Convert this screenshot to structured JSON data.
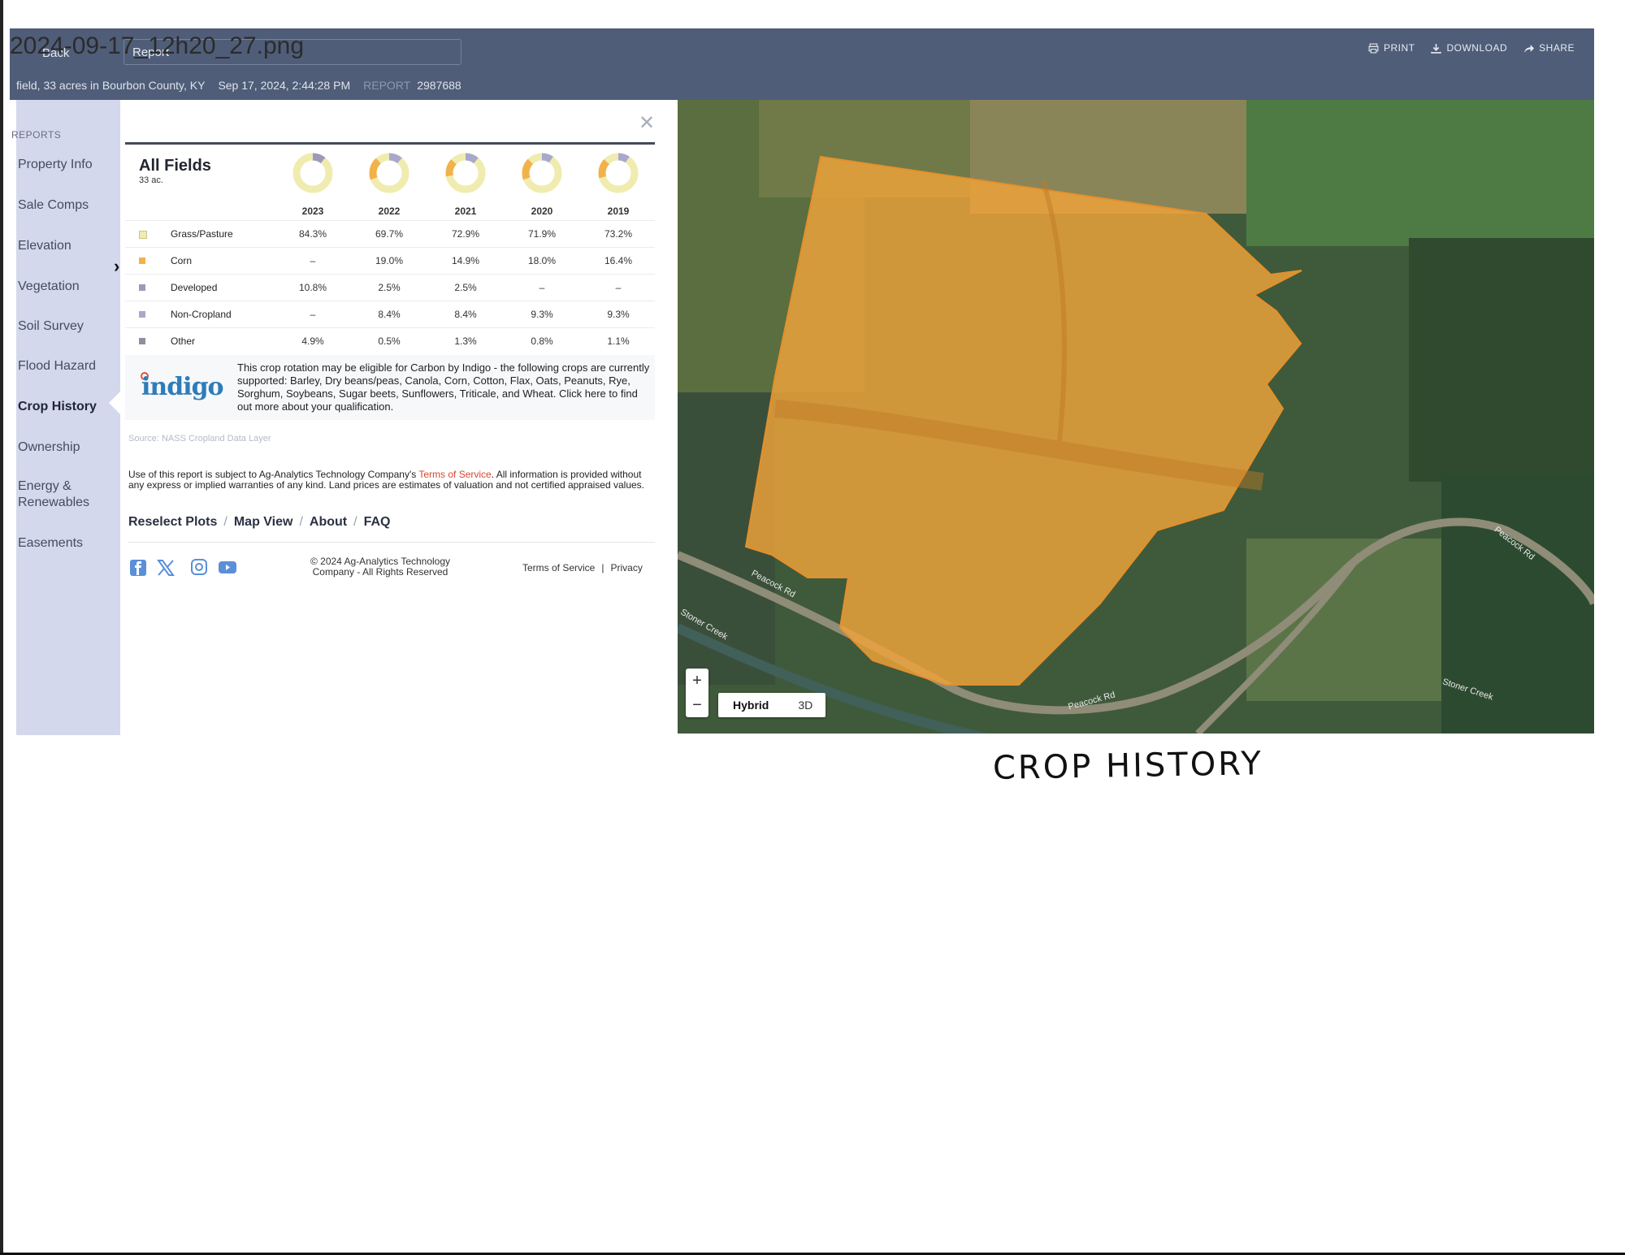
{
  "file_name": "2024-09-17_12h20_27.png",
  "header": {
    "back_label": "Back",
    "report_select_value": "Report",
    "actions": [
      {
        "label": "PRINT",
        "icon": "printer-icon"
      },
      {
        "label": "DOWNLOAD",
        "icon": "download-icon"
      },
      {
        "label": "SHARE",
        "icon": "share-icon"
      }
    ],
    "field_desc": "field, 33 acres in Bourbon County, KY",
    "date": "Sep 17, 2024, 2:44:28 PM",
    "report_label": "REPORT",
    "report_id": "2987688"
  },
  "sidebar": {
    "header": "REPORTS",
    "items": [
      {
        "label": "Property Info"
      },
      {
        "label": "Sale Comps"
      },
      {
        "label": "Elevation"
      },
      {
        "label": "Vegetation"
      },
      {
        "label": "Soil Survey"
      },
      {
        "label": "Flood Hazard"
      },
      {
        "label": "Crop History",
        "active": true
      },
      {
        "label": "Ownership"
      },
      {
        "label": "Energy &\nRenewables"
      },
      {
        "label": "Easements"
      }
    ]
  },
  "crop_table": {
    "title": "All Fields",
    "acres": "33 ac.",
    "years": [
      "2023",
      "2022",
      "2021",
      "2020",
      "2019"
    ],
    "rows": [
      {
        "crop": "Grass/Pasture",
        "color": "#f0ecb0",
        "values": [
          "84.3%",
          "69.7%",
          "72.9%",
          "71.9%",
          "73.2%"
        ]
      },
      {
        "crop": "Corn",
        "color": "#f2b24a",
        "values": [
          "–",
          "19.0%",
          "14.9%",
          "18.0%",
          "16.4%"
        ]
      },
      {
        "crop": "Developed",
        "color": "#9c9ab8",
        "values": [
          "10.8%",
          "2.5%",
          "2.5%",
          "–",
          "–"
        ]
      },
      {
        "crop": "Non-Cropland",
        "color": "#a9a8cc",
        "values": [
          "–",
          "8.4%",
          "8.4%",
          "9.3%",
          "9.3%"
        ]
      },
      {
        "crop": "Other",
        "color": "#8f8f9f",
        "values": [
          "4.9%",
          "0.5%",
          "1.3%",
          "0.8%",
          "1.1%"
        ]
      }
    ]
  },
  "indigo": {
    "logo": "indigo",
    "text": "This crop rotation may be eligible for Carbon by Indigo - the following crops are currently supported: Barley, Dry beans/peas, Canola, Corn, Cotton, Flax, Oats, Peanuts, Rye, Sorghum, Soybeans, Sugar beets, Sunflowers, Triticale, and Wheat. Click here to find out more about your qualification."
  },
  "source": "Source: NASS Cropland Data Layer",
  "legal": {
    "before": "Use of this report is subject to Ag-Analytics Technology Company's ",
    "tos": "Terms of Service",
    "after": ". All information is provided without any express or implied warranties of any kind. Land prices are estimates of valuation and not certified appraised values."
  },
  "links": [
    "Reselect Plots",
    "Map View",
    "About",
    "FAQ"
  ],
  "footer": {
    "copyright": "© 2024 Ag-Analytics Technology Company - All Rights Reserved",
    "terms": "Terms of Service",
    "privacy": "Privacy",
    "socials": [
      "facebook-icon",
      "x-icon",
      "instagram-icon",
      "youtube-icon"
    ]
  },
  "map": {
    "zoom_in": "+",
    "zoom_out": "−",
    "type_options": [
      "Hybrid",
      "3D"
    ],
    "selected_type": "Hybrid",
    "road_labels": [
      "Peacock Rd",
      "Peacock Rd",
      "Peacock Rd",
      "Stoner Creek",
      "Stoner Creek"
    ],
    "field_color": "#f0a33a"
  },
  "handwritten_note": "CROP HISTORY"
}
